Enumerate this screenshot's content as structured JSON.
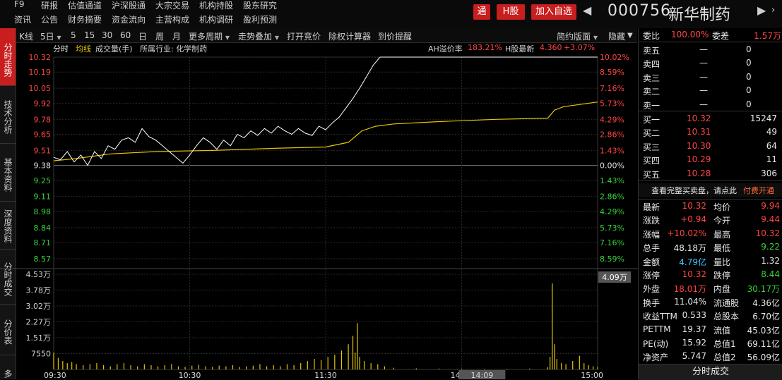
{
  "menu": {
    "row1": [
      "F9",
      "研报",
      "估值通道",
      "沪深股通",
      "大宗交易",
      "机构持股",
      "股东研究"
    ],
    "row2": [
      "资讯",
      "公告",
      "财务摘要",
      "资金流向",
      "主营构成",
      "机构调研",
      "盈利预测"
    ]
  },
  "top_buttons": {
    "tong": "通",
    "hgu": "H股",
    "add": "加入自选"
  },
  "stock": {
    "code": "000756",
    "name": "新华制药"
  },
  "left_tabs": [
    {
      "label": "分时走势",
      "active": true
    },
    {
      "label": "技术分析",
      "active": false
    },
    {
      "label": "基本资料",
      "active": false
    },
    {
      "label": "深度资料",
      "active": false
    },
    {
      "label": "分时成交",
      "active": false
    },
    {
      "label": "分价表",
      "active": false
    },
    {
      "label": "多",
      "active": false
    }
  ],
  "toolbar": {
    "kline": "K线",
    "period": "5日",
    "p5": "5",
    "p15": "15",
    "p30": "30",
    "p60": "60",
    "day": "日",
    "week": "周",
    "month": "月",
    "more_period": "更多周期",
    "trend_overlay": "走势叠加",
    "open_auction": "打开竞价",
    "ex_right": "除权计算器",
    "price_alert": "到价提醒",
    "layout": "简约版面",
    "hide": "隐藏"
  },
  "legend": {
    "fenshi": "分时",
    "junxian": "均线",
    "volume": "成交量(手)",
    "industry": "所属行业: 化学制药",
    "ah_label": "AH溢价率",
    "ah_value": "183.21%",
    "h_label": "H股最新",
    "h_price": "4.360",
    "h_change": "+3.07%"
  },
  "chart_data": {
    "type": "line",
    "prev_close": 9.38,
    "price_ticks": [
      "10.32",
      "10.19",
      "10.05",
      "9.92",
      "9.78",
      "9.65",
      "9.51",
      "9.38",
      "9.25",
      "9.11",
      "8.98",
      "8.84",
      "8.71",
      "8.57"
    ],
    "pct_ticks": [
      "10.02%",
      "8.59%",
      "7.16%",
      "5.73%",
      "4.29%",
      "2.86%",
      "1.43%",
      "0.00%",
      "1.43%",
      "2.86%",
      "4.29%",
      "5.73%",
      "7.16%",
      "8.59%"
    ],
    "vol_ticks": [
      "4.53万",
      "3.78万",
      "3.02万",
      "2.27万",
      "1.51万",
      "7550"
    ],
    "vol_cursor_label": "4.09万",
    "x_ticks": [
      "09:30",
      "10:30",
      "11:30",
      "14:00",
      "14:09",
      "15:00"
    ],
    "colors": {
      "up": "#ff4444",
      "down": "#39d339",
      "neutral": "#e0e0e0",
      "price_line": "#ffffff",
      "avg_line": "#e6c600",
      "volume": "#e6c600"
    },
    "series": [
      {
        "name": "分时",
        "points": [
          [
            0,
            9.45
          ],
          [
            3,
            9.43
          ],
          [
            6,
            9.5
          ],
          [
            9,
            9.41
          ],
          [
            12,
            9.47
          ],
          [
            15,
            9.38
          ],
          [
            18,
            9.5
          ],
          [
            21,
            9.44
          ],
          [
            24,
            9.55
          ],
          [
            27,
            9.52
          ],
          [
            30,
            9.6
          ],
          [
            33,
            9.62
          ],
          [
            36,
            9.58
          ],
          [
            39,
            9.7
          ],
          [
            42,
            9.63
          ],
          [
            45,
            9.6
          ],
          [
            48,
            9.55
          ],
          [
            51,
            9.5
          ],
          [
            54,
            9.45
          ],
          [
            57,
            9.4
          ],
          [
            60,
            9.47
          ],
          [
            63,
            9.55
          ],
          [
            66,
            9.62
          ],
          [
            69,
            9.58
          ],
          [
            72,
            9.52
          ],
          [
            75,
            9.6
          ],
          [
            78,
            9.55
          ],
          [
            81,
            9.65
          ],
          [
            84,
            9.62
          ],
          [
            87,
            9.68
          ],
          [
            90,
            9.64
          ],
          [
            93,
            9.7
          ],
          [
            96,
            9.66
          ],
          [
            99,
            9.72
          ],
          [
            102,
            9.68
          ],
          [
            105,
            9.65
          ],
          [
            108,
            9.7
          ],
          [
            111,
            9.66
          ],
          [
            114,
            9.64
          ],
          [
            117,
            9.72
          ],
          [
            120,
            9.69
          ],
          [
            123,
            9.75
          ],
          [
            126,
            9.8
          ],
          [
            129,
            9.88
          ],
          [
            132,
            9.96
          ],
          [
            135,
            10.05
          ],
          [
            138,
            10.15
          ],
          [
            141,
            10.25
          ],
          [
            144,
            10.32
          ],
          [
            240,
            10.32
          ]
        ]
      },
      {
        "name": "均线",
        "points": [
          [
            0,
            9.42
          ],
          [
            10,
            9.44
          ],
          [
            25,
            9.48
          ],
          [
            45,
            9.5
          ],
          [
            70,
            9.51
          ],
          [
            100,
            9.53
          ],
          [
            120,
            9.54
          ],
          [
            130,
            9.58
          ],
          [
            136,
            9.68
          ],
          [
            142,
            9.72
          ],
          [
            150,
            9.74
          ],
          [
            170,
            9.76
          ],
          [
            195,
            9.78
          ],
          [
            218,
            9.79
          ],
          [
            221,
            9.86
          ],
          [
            225,
            9.89
          ],
          [
            240,
            9.93
          ]
        ]
      }
    ],
    "volume": [
      [
        0,
        8000
      ],
      [
        2,
        5500
      ],
      [
        4,
        4000
      ],
      [
        6,
        3000
      ],
      [
        8,
        3500
      ],
      [
        10,
        2500
      ],
      [
        13,
        2000
      ],
      [
        16,
        2500
      ],
      [
        19,
        3000
      ],
      [
        22,
        2000
      ],
      [
        25,
        1500
      ],
      [
        28,
        2500
      ],
      [
        31,
        3000
      ],
      [
        34,
        2000
      ],
      [
        37,
        1500
      ],
      [
        40,
        2500
      ],
      [
        43,
        2000
      ],
      [
        46,
        1500
      ],
      [
        49,
        2000
      ],
      [
        52,
        2500
      ],
      [
        55,
        1500
      ],
      [
        58,
        1200
      ],
      [
        61,
        1800
      ],
      [
        64,
        2200
      ],
      [
        67,
        1500
      ],
      [
        70,
        1200
      ],
      [
        73,
        1800
      ],
      [
        76,
        1500
      ],
      [
        79,
        2000
      ],
      [
        82,
        1200
      ],
      [
        85,
        1500
      ],
      [
        88,
        1800
      ],
      [
        91,
        2500
      ],
      [
        94,
        1500
      ],
      [
        97,
        2000
      ],
      [
        100,
        1500
      ],
      [
        103,
        2500
      ],
      [
        106,
        2000
      ],
      [
        109,
        3000
      ],
      [
        112,
        4000
      ],
      [
        115,
        5000
      ],
      [
        118,
        4500
      ],
      [
        121,
        6000
      ],
      [
        124,
        7000
      ],
      [
        127,
        9000
      ],
      [
        130,
        12000
      ],
      [
        132,
        16000
      ],
      [
        133,
        8000
      ],
      [
        134,
        22000
      ],
      [
        135,
        6000
      ],
      [
        137,
        4000
      ],
      [
        140,
        3000
      ],
      [
        143,
        2500
      ],
      [
        146,
        1500
      ],
      [
        150,
        800
      ],
      [
        160,
        500
      ],
      [
        170,
        400
      ],
      [
        180,
        300
      ],
      [
        190,
        300
      ],
      [
        200,
        300
      ],
      [
        210,
        400
      ],
      [
        218,
        1000
      ],
      [
        219,
        6000
      ],
      [
        220,
        40900
      ],
      [
        221,
        12000
      ],
      [
        222,
        5000
      ],
      [
        224,
        3000
      ],
      [
        226,
        2500
      ],
      [
        229,
        4000
      ],
      [
        232,
        6500
      ],
      [
        234,
        3000
      ],
      [
        236,
        2000
      ],
      [
        238,
        1500
      ],
      [
        240,
        1200
      ]
    ]
  },
  "panel": {
    "weibi_label": "委比",
    "weibi_value": "100.00%",
    "weicha_label": "委差",
    "weicha_value": "1.57万",
    "asks": [
      {
        "label": "卖五",
        "price": "—",
        "vol": "0"
      },
      {
        "label": "卖四",
        "price": "—",
        "vol": "0"
      },
      {
        "label": "卖三",
        "price": "—",
        "vol": "0"
      },
      {
        "label": "卖二",
        "price": "—",
        "vol": "0"
      },
      {
        "label": "卖一",
        "price": "—",
        "vol": "0"
      }
    ],
    "bids": [
      {
        "label": "买一",
        "price": "10.32",
        "vol": "15247"
      },
      {
        "label": "买二",
        "price": "10.31",
        "vol": "49"
      },
      {
        "label": "买三",
        "price": "10.30",
        "vol": "64"
      },
      {
        "label": "买四",
        "price": "10.29",
        "vol": "11"
      },
      {
        "label": "买五",
        "price": "10.28",
        "vol": "306"
      }
    ],
    "fulldepth_text": "查看完整买卖盘，请点此",
    "fulldepth_link": "付费开通",
    "stats": [
      {
        "l1": "最新",
        "v1": "10.32",
        "c1": "red",
        "l2": "均价",
        "v2": "9.94",
        "c2": "red"
      },
      {
        "l1": "涨跌",
        "v1": "+0.94",
        "c1": "red",
        "l2": "今开",
        "v2": "9.44",
        "c2": "red"
      },
      {
        "l1": "涨幅",
        "v1": "+10.02%",
        "c1": "red",
        "l2": "最高",
        "v2": "10.32",
        "c2": "red"
      },
      {
        "l1": "总手",
        "v1": "48.18万",
        "c1": "white",
        "l2": "最低",
        "v2": "9.22",
        "c2": "green"
      },
      {
        "l1": "金额",
        "v1": "4.79亿",
        "c1": "cyan",
        "l2": "量比",
        "v2": "1.32",
        "c2": "white"
      },
      {
        "l1": "涨停",
        "v1": "10.32",
        "c1": "red",
        "l2": "跌停",
        "v2": "8.44",
        "c2": "green"
      },
      {
        "l1": "外盘",
        "v1": "18.01万",
        "c1": "red",
        "l2": "内盘",
        "v2": "30.17万",
        "c2": "green"
      },
      {
        "l1": "换手",
        "v1": "11.04%",
        "c1": "white",
        "l2": "流通股",
        "v2": "4.36亿",
        "c2": "white"
      },
      {
        "l1": "收益TTM",
        "v1": "0.533",
        "c1": "white",
        "l2": "总股本",
        "v2": "6.70亿",
        "c2": "white"
      },
      {
        "l1": "PETTM",
        "v1": "19.37",
        "c1": "white",
        "l2": "流值",
        "v2": "45.03亿",
        "c2": "white"
      },
      {
        "l1": "PE(动)",
        "v1": "15.92",
        "c1": "white",
        "l2": "总值1",
        "v2": "69.11亿",
        "c2": "white"
      },
      {
        "l1": "净资产",
        "v1": "5.747",
        "c1": "white",
        "l2": "总值2",
        "v2": "56.09亿",
        "c2": "white"
      }
    ],
    "bottom_tab": "分时成交"
  },
  "icons": {
    "prev": "triangle-left-icon",
    "next": "triangle-right-icon",
    "more": "chevron-right-icon",
    "dropdown": "triangle-down-icon"
  }
}
